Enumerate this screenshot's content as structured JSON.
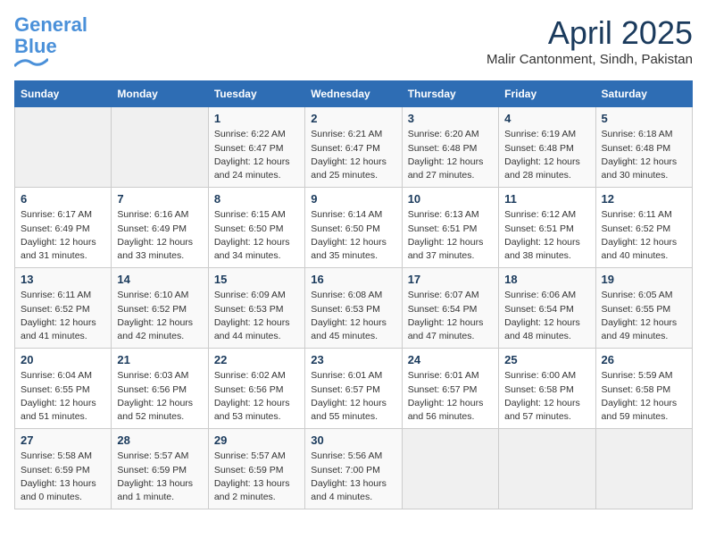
{
  "header": {
    "logo_general": "General",
    "logo_blue": "Blue",
    "month_title": "April 2025",
    "location": "Malir Cantonment, Sindh, Pakistan"
  },
  "days_of_week": [
    "Sunday",
    "Monday",
    "Tuesday",
    "Wednesday",
    "Thursday",
    "Friday",
    "Saturday"
  ],
  "weeks": [
    [
      {
        "num": "",
        "sunrise": "",
        "sunset": "",
        "daylight": ""
      },
      {
        "num": "",
        "sunrise": "",
        "sunset": "",
        "daylight": ""
      },
      {
        "num": "1",
        "sunrise": "Sunrise: 6:22 AM",
        "sunset": "Sunset: 6:47 PM",
        "daylight": "Daylight: 12 hours and 24 minutes."
      },
      {
        "num": "2",
        "sunrise": "Sunrise: 6:21 AM",
        "sunset": "Sunset: 6:47 PM",
        "daylight": "Daylight: 12 hours and 25 minutes."
      },
      {
        "num": "3",
        "sunrise": "Sunrise: 6:20 AM",
        "sunset": "Sunset: 6:48 PM",
        "daylight": "Daylight: 12 hours and 27 minutes."
      },
      {
        "num": "4",
        "sunrise": "Sunrise: 6:19 AM",
        "sunset": "Sunset: 6:48 PM",
        "daylight": "Daylight: 12 hours and 28 minutes."
      },
      {
        "num": "5",
        "sunrise": "Sunrise: 6:18 AM",
        "sunset": "Sunset: 6:48 PM",
        "daylight": "Daylight: 12 hours and 30 minutes."
      }
    ],
    [
      {
        "num": "6",
        "sunrise": "Sunrise: 6:17 AM",
        "sunset": "Sunset: 6:49 PM",
        "daylight": "Daylight: 12 hours and 31 minutes."
      },
      {
        "num": "7",
        "sunrise": "Sunrise: 6:16 AM",
        "sunset": "Sunset: 6:49 PM",
        "daylight": "Daylight: 12 hours and 33 minutes."
      },
      {
        "num": "8",
        "sunrise": "Sunrise: 6:15 AM",
        "sunset": "Sunset: 6:50 PM",
        "daylight": "Daylight: 12 hours and 34 minutes."
      },
      {
        "num": "9",
        "sunrise": "Sunrise: 6:14 AM",
        "sunset": "Sunset: 6:50 PM",
        "daylight": "Daylight: 12 hours and 35 minutes."
      },
      {
        "num": "10",
        "sunrise": "Sunrise: 6:13 AM",
        "sunset": "Sunset: 6:51 PM",
        "daylight": "Daylight: 12 hours and 37 minutes."
      },
      {
        "num": "11",
        "sunrise": "Sunrise: 6:12 AM",
        "sunset": "Sunset: 6:51 PM",
        "daylight": "Daylight: 12 hours and 38 minutes."
      },
      {
        "num": "12",
        "sunrise": "Sunrise: 6:11 AM",
        "sunset": "Sunset: 6:52 PM",
        "daylight": "Daylight: 12 hours and 40 minutes."
      }
    ],
    [
      {
        "num": "13",
        "sunrise": "Sunrise: 6:11 AM",
        "sunset": "Sunset: 6:52 PM",
        "daylight": "Daylight: 12 hours and 41 minutes."
      },
      {
        "num": "14",
        "sunrise": "Sunrise: 6:10 AM",
        "sunset": "Sunset: 6:52 PM",
        "daylight": "Daylight: 12 hours and 42 minutes."
      },
      {
        "num": "15",
        "sunrise": "Sunrise: 6:09 AM",
        "sunset": "Sunset: 6:53 PM",
        "daylight": "Daylight: 12 hours and 44 minutes."
      },
      {
        "num": "16",
        "sunrise": "Sunrise: 6:08 AM",
        "sunset": "Sunset: 6:53 PM",
        "daylight": "Daylight: 12 hours and 45 minutes."
      },
      {
        "num": "17",
        "sunrise": "Sunrise: 6:07 AM",
        "sunset": "Sunset: 6:54 PM",
        "daylight": "Daylight: 12 hours and 47 minutes."
      },
      {
        "num": "18",
        "sunrise": "Sunrise: 6:06 AM",
        "sunset": "Sunset: 6:54 PM",
        "daylight": "Daylight: 12 hours and 48 minutes."
      },
      {
        "num": "19",
        "sunrise": "Sunrise: 6:05 AM",
        "sunset": "Sunset: 6:55 PM",
        "daylight": "Daylight: 12 hours and 49 minutes."
      }
    ],
    [
      {
        "num": "20",
        "sunrise": "Sunrise: 6:04 AM",
        "sunset": "Sunset: 6:55 PM",
        "daylight": "Daylight: 12 hours and 51 minutes."
      },
      {
        "num": "21",
        "sunrise": "Sunrise: 6:03 AM",
        "sunset": "Sunset: 6:56 PM",
        "daylight": "Daylight: 12 hours and 52 minutes."
      },
      {
        "num": "22",
        "sunrise": "Sunrise: 6:02 AM",
        "sunset": "Sunset: 6:56 PM",
        "daylight": "Daylight: 12 hours and 53 minutes."
      },
      {
        "num": "23",
        "sunrise": "Sunrise: 6:01 AM",
        "sunset": "Sunset: 6:57 PM",
        "daylight": "Daylight: 12 hours and 55 minutes."
      },
      {
        "num": "24",
        "sunrise": "Sunrise: 6:01 AM",
        "sunset": "Sunset: 6:57 PM",
        "daylight": "Daylight: 12 hours and 56 minutes."
      },
      {
        "num": "25",
        "sunrise": "Sunrise: 6:00 AM",
        "sunset": "Sunset: 6:58 PM",
        "daylight": "Daylight: 12 hours and 57 minutes."
      },
      {
        "num": "26",
        "sunrise": "Sunrise: 5:59 AM",
        "sunset": "Sunset: 6:58 PM",
        "daylight": "Daylight: 12 hours and 59 minutes."
      }
    ],
    [
      {
        "num": "27",
        "sunrise": "Sunrise: 5:58 AM",
        "sunset": "Sunset: 6:59 PM",
        "daylight": "Daylight: 13 hours and 0 minutes."
      },
      {
        "num": "28",
        "sunrise": "Sunrise: 5:57 AM",
        "sunset": "Sunset: 6:59 PM",
        "daylight": "Daylight: 13 hours and 1 minute."
      },
      {
        "num": "29",
        "sunrise": "Sunrise: 5:57 AM",
        "sunset": "Sunset: 6:59 PM",
        "daylight": "Daylight: 13 hours and 2 minutes."
      },
      {
        "num": "30",
        "sunrise": "Sunrise: 5:56 AM",
        "sunset": "Sunset: 7:00 PM",
        "daylight": "Daylight: 13 hours and 4 minutes."
      },
      {
        "num": "",
        "sunrise": "",
        "sunset": "",
        "daylight": ""
      },
      {
        "num": "",
        "sunrise": "",
        "sunset": "",
        "daylight": ""
      },
      {
        "num": "",
        "sunrise": "",
        "sunset": "",
        "daylight": ""
      }
    ]
  ]
}
